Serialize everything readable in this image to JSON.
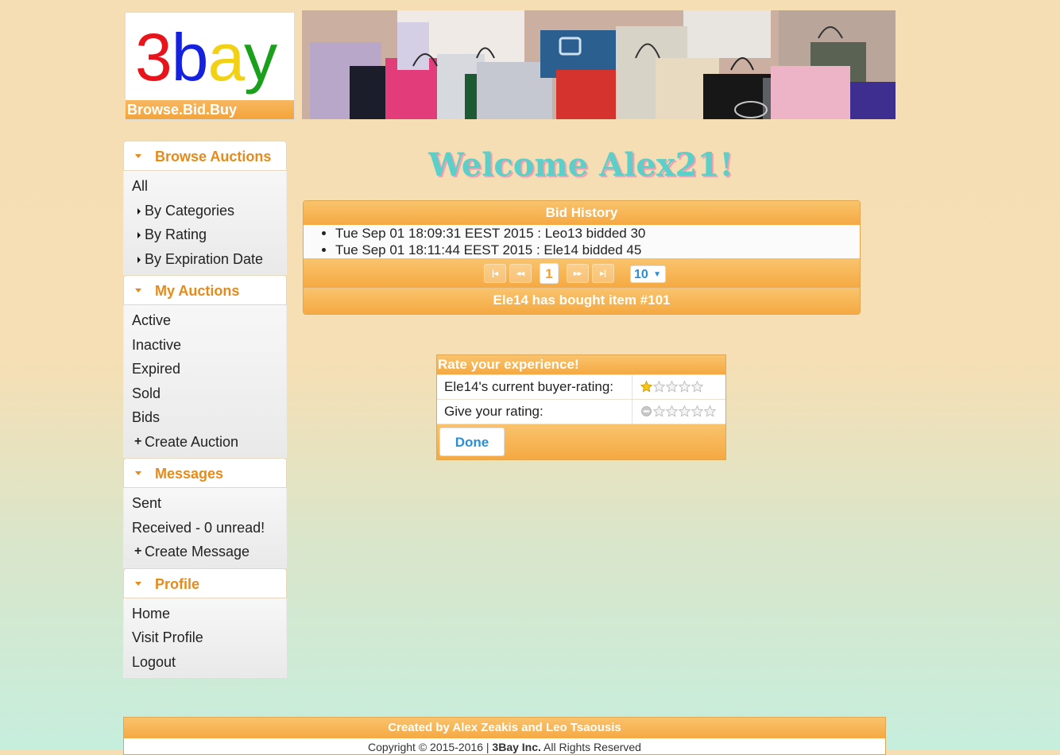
{
  "header": {
    "logo_letters": [
      "3",
      "b",
      "a",
      "y"
    ],
    "logo_colors": [
      "#e8141c",
      "#1422e0",
      "#f2d014",
      "#1aa01a"
    ],
    "tagline": "Browse.Bid.Buy"
  },
  "sidebar": {
    "browse": {
      "title": "Browse Auctions",
      "items": [
        "All",
        "By Categories",
        "By Rating",
        "By Expiration Date"
      ]
    },
    "my_auctions": {
      "title": "My Auctions",
      "items": [
        "Active",
        "Inactive",
        "Expired",
        "Sold",
        "Bids",
        "Create Auction"
      ]
    },
    "messages": {
      "title": "Messages",
      "items": [
        "Sent",
        "Received - 0 unread!",
        "Create Message"
      ]
    },
    "profile": {
      "title": "Profile",
      "items": [
        "Home",
        "Visit Profile",
        "Logout"
      ]
    }
  },
  "main": {
    "welcome": "Welcome Alex21!",
    "bid_history": {
      "title": "Bid History",
      "entries": [
        "Tue Sep 01 18:09:31 EEST 2015 : Leo13 bidded 30",
        "Tue Sep 01 18:11:44 EEST 2015 : Ele14 bidded 45"
      ],
      "pager": {
        "first": "|◂",
        "prev": "◂◂",
        "next": "▸▸",
        "last": "▸|",
        "current_page": "1",
        "page_size": "10"
      },
      "footer": "Ele14 has bought item #101"
    },
    "rating": {
      "title": "Rate your experience!",
      "current_label": "Ele14's current buyer-rating:",
      "current_rating": 1,
      "give_label": "Give your rating:",
      "give_rating": 0,
      "max_rating": 5,
      "done_label": "Done"
    }
  },
  "footer": {
    "credits": "Created by Alex Zeakis and Leo Tsaousis",
    "copyright_prefix": "Copyright © 2015-2016 | ",
    "company": "3Bay Inc.",
    "copyright_suffix": " All Rights Reserved"
  },
  "colors": {
    "accent_orange": "#f5a942",
    "heading_orange": "#e68a1a",
    "welcome_teal": "#5ccfc8",
    "link_blue": "#2a8fd4"
  }
}
